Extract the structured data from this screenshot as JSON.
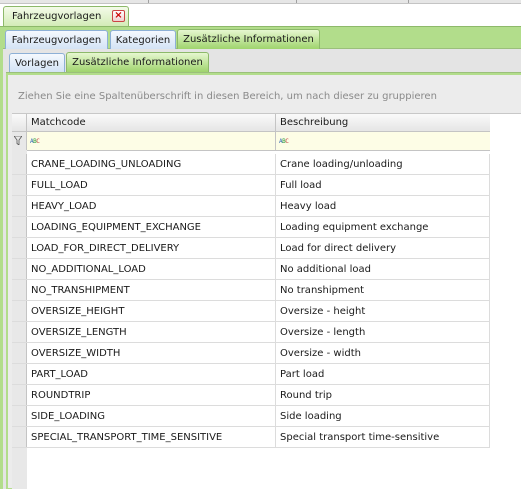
{
  "document_tab": {
    "label": "Fahrzeugvorlagen",
    "close_icon": "close-icon"
  },
  "tabs_level1": [
    {
      "label": "Fahrzeugvorlagen",
      "active": false
    },
    {
      "label": "Kategorien",
      "active": false
    },
    {
      "label": "Zusätzliche Informationen",
      "active": true
    }
  ],
  "tabs_level2": [
    {
      "label": "Vorlagen",
      "active": false
    },
    {
      "label": "Zusätzliche Informationen",
      "active": true
    }
  ],
  "grid": {
    "group_hint": "Ziehen Sie eine Spaltenüberschrift in diesen Bereich, um nach dieser zu gruppieren",
    "columns": [
      "Matchcode",
      "Beschreibung"
    ],
    "filter_icon": "funnel-icon",
    "filter_cell_icon": "abc-filter-icon",
    "rows": [
      [
        "CRANE_LOADING_UNLOADING",
        "Crane loading/unloading"
      ],
      [
        "FULL_LOAD",
        "Full load"
      ],
      [
        "HEAVY_LOAD",
        "Heavy load"
      ],
      [
        "LOADING_EQUIPMENT_EXCHANGE",
        "Loading equipment exchange"
      ],
      [
        "LOAD_FOR_DIRECT_DELIVERY",
        "Load for direct delivery"
      ],
      [
        "NO_ADDITIONAL_LOAD",
        "No additional load"
      ],
      [
        "NO_TRANSHIPMENT",
        "No transhipment"
      ],
      [
        "OVERSIZE_HEIGHT",
        "Oversize - height"
      ],
      [
        "OVERSIZE_LENGTH",
        "Oversize - length"
      ],
      [
        "OVERSIZE_WIDTH",
        "Oversize - width"
      ],
      [
        "PART_LOAD",
        "Part load"
      ],
      [
        "ROUNDTRIP",
        "Round trip"
      ],
      [
        "SIDE_LOADING",
        "Side loading"
      ],
      [
        "SPECIAL_TRANSPORT_TIME_SENSITIVE",
        "Special transport time-sensitive"
      ]
    ]
  }
}
